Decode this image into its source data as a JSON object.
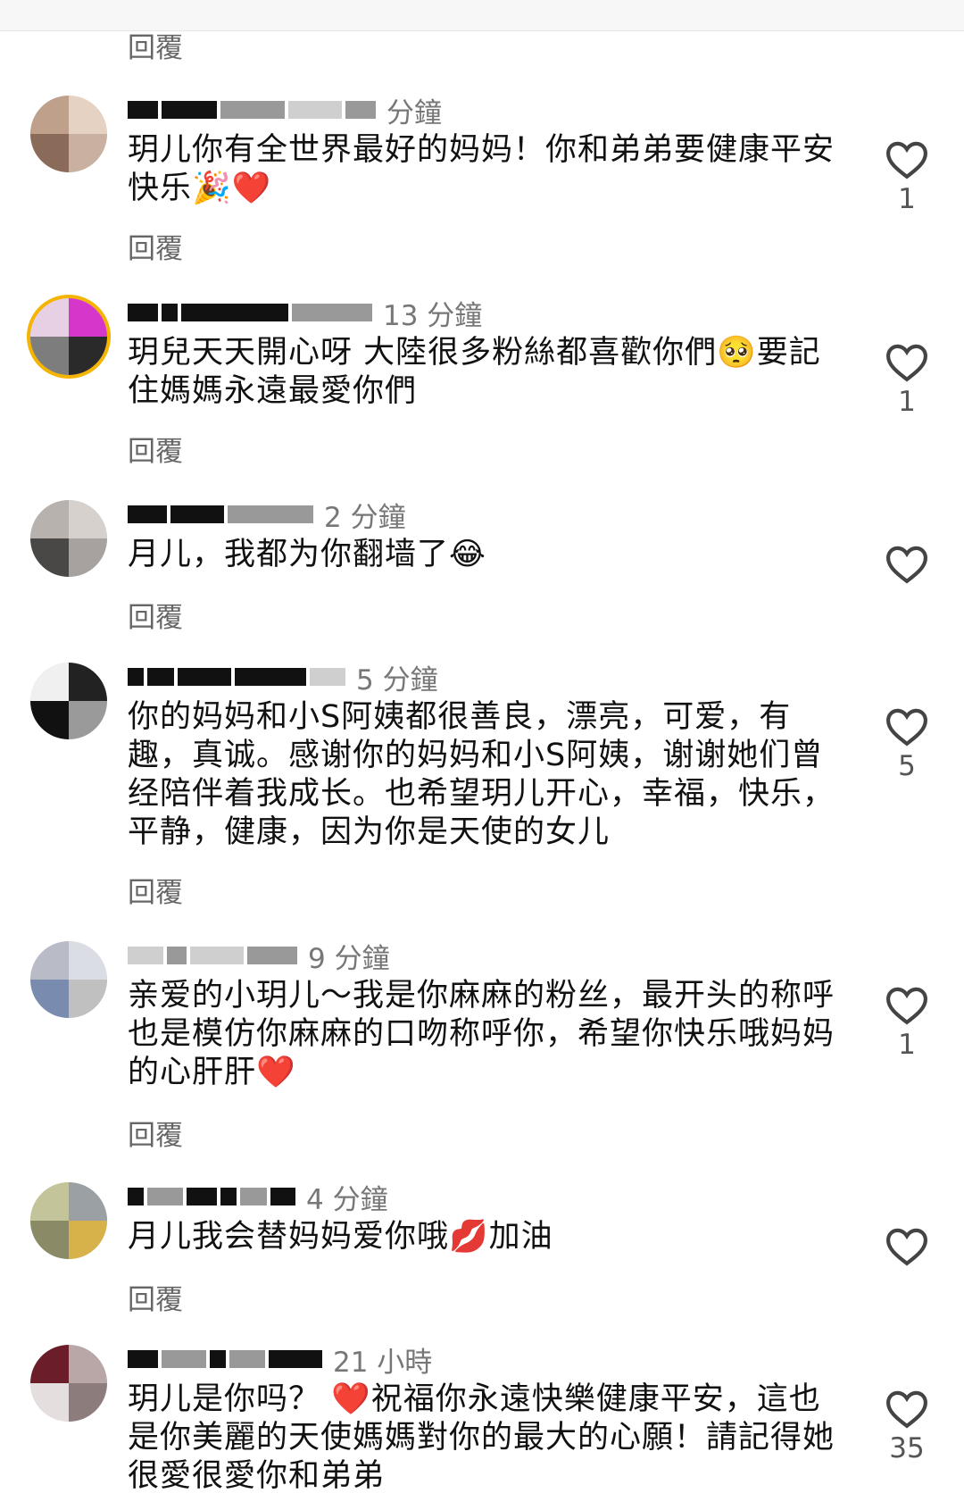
{
  "reply_label": "回覆",
  "comments": [
    {
      "time": "分鐘",
      "text": "玥儿你有全世界最好的妈妈！你和弟弟要健康平安快乐🎉❤️",
      "likes": "1"
    },
    {
      "time": "13 分鐘",
      "text": "玥兒天天開心呀 大陸很多粉絲都喜歡你們🥺要記住媽媽永遠最愛你們",
      "likes": "1"
    },
    {
      "time": "2 分鐘",
      "text": "月儿，我都为你翻墙了😂",
      "likes": ""
    },
    {
      "time": "5 分鐘",
      "text": "你的妈妈和小S阿姨都很善良，漂亮，可爱，有趣，真诚。感谢你的妈妈和小S阿姨，谢谢她们曾经陪伴着我成长。也希望玥儿开心，幸福，快乐，平静，健康，因为你是天使的女儿",
      "likes": "5"
    },
    {
      "time": "9 分鐘",
      "text": "亲爱的小玥儿～我是你麻麻的粉丝，最开头的称呼也是模仿你麻麻的口吻称呼你，希望你快乐哦妈妈的心肝肝❤️",
      "likes": "1"
    },
    {
      "time": "4 分鐘",
      "text": "月儿我会替妈妈爱你哦💋加油",
      "likes": ""
    },
    {
      "time": "21 小時",
      "text": "玥儿是你吗？ ❤️祝福你永遠快樂健康平安，這也是你美麗的天使媽媽對你的最大的心願！請記得她很愛很愛你和弟弟",
      "likes": "35"
    }
  ]
}
